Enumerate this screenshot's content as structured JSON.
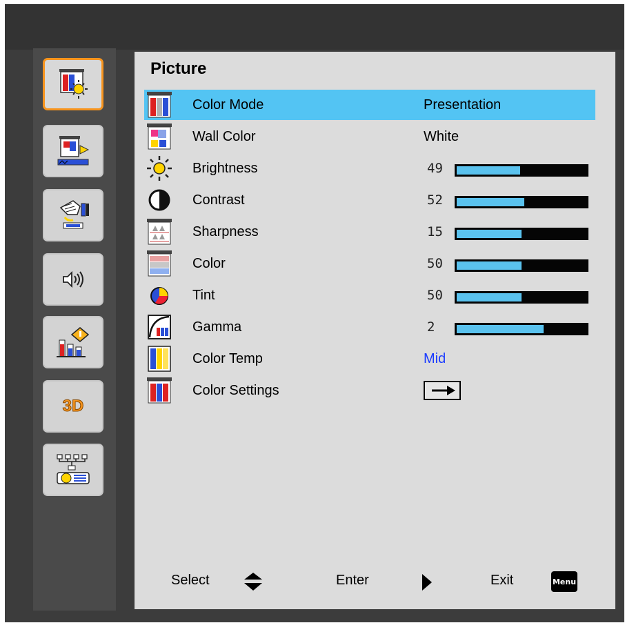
{
  "panel": {
    "title": "Picture"
  },
  "sidebar": {
    "items": [
      {
        "name": "picture",
        "icon": "picture-icon",
        "active": true
      },
      {
        "name": "display",
        "icon": "display-icon"
      },
      {
        "name": "setup",
        "icon": "setup-icon"
      },
      {
        "name": "audio",
        "icon": "speaker-icon"
      },
      {
        "name": "options",
        "icon": "options-icon"
      },
      {
        "name": "3d",
        "icon": "3d-icon",
        "label": "3D"
      },
      {
        "name": "network",
        "icon": "network-icon"
      }
    ]
  },
  "menu": {
    "color_mode": {
      "label": "Color Mode",
      "value": "Presentation",
      "icon": "color-mode-icon"
    },
    "wall_color": {
      "label": "Wall Color",
      "value": "White",
      "icon": "wall-color-icon"
    },
    "brightness": {
      "label": "Brightness",
      "value": "49",
      "level": 0.49,
      "icon": "brightness-icon"
    },
    "contrast": {
      "label": "Contrast",
      "value": "52",
      "level": 0.52,
      "icon": "contrast-icon"
    },
    "sharpness": {
      "label": "Sharpness",
      "value": "15",
      "level": 0.5,
      "icon": "sharpness-icon"
    },
    "color": {
      "label": "Color",
      "value": "50",
      "level": 0.5,
      "icon": "color-icon"
    },
    "tint": {
      "label": "Tint",
      "value": "50",
      "level": 0.5,
      "icon": "tint-icon"
    },
    "gamma": {
      "label": "Gamma",
      "value": "2",
      "level": 0.67,
      "icon": "gamma-icon"
    },
    "color_temp": {
      "label": "Color Temp",
      "value": "Mid",
      "icon": "color-temp-icon"
    },
    "color_settings": {
      "label": "Color Settings",
      "icon": "arrow-right-icon"
    }
  },
  "footer": {
    "select": "Select",
    "enter": "Enter",
    "exit": "Exit",
    "menu_key": "Menu"
  },
  "colors": {
    "highlight": "#53c4f3",
    "bar_fill": "#5ac2ee",
    "active_border": "#f7941d",
    "value_blue": "#1a3bff"
  }
}
